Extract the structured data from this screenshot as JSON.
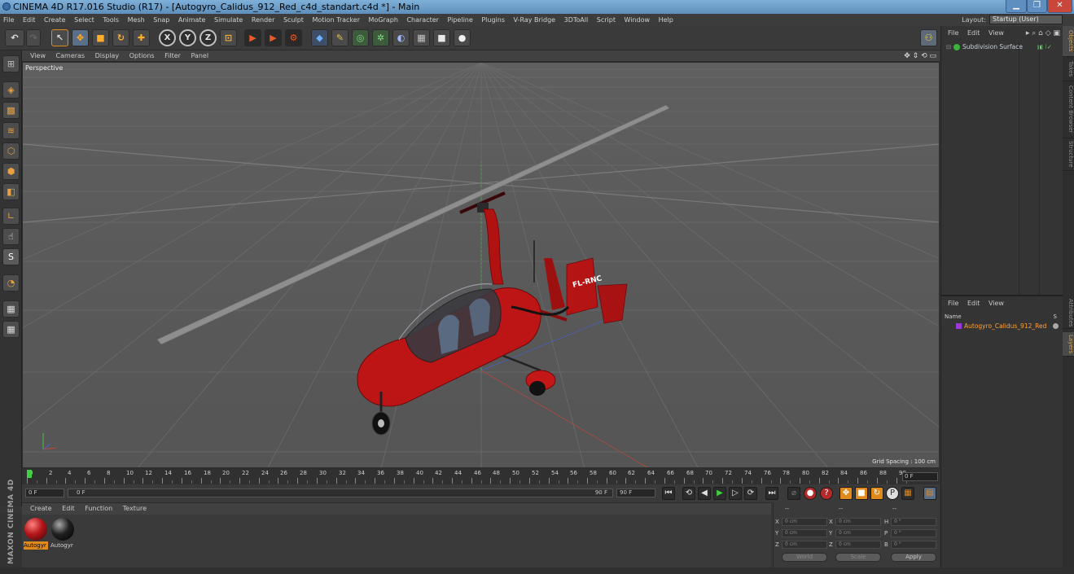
{
  "window": {
    "title": "CINEMA 4D R17.016 Studio (R17) - [Autogyro_Calidus_912_Red_c4d_standart.c4d *] - Main"
  },
  "menubar": {
    "items": [
      "File",
      "Edit",
      "Create",
      "Select",
      "Tools",
      "Mesh",
      "Snap",
      "Animate",
      "Simulate",
      "Render",
      "Sculpt",
      "Motion Tracker",
      "MoGraph",
      "Character",
      "Pipeline",
      "Plugins",
      "V-Ray Bridge",
      "3DToAll",
      "Script",
      "Window",
      "Help"
    ],
    "layout_label": "Layout:",
    "layout_value": "Startup (User)"
  },
  "toolbar": {
    "axis_x": "X",
    "axis_y": "Y",
    "axis_z": "Z"
  },
  "viewport": {
    "menu": [
      "View",
      "Cameras",
      "Display",
      "Options",
      "Filter",
      "Panel"
    ],
    "label": "Perspective",
    "grid_spacing": "Grid Spacing : 100 cm",
    "model_tail_text": "FL-RNC"
  },
  "timeline": {
    "ticks": [
      "0",
      "2",
      "4",
      "6",
      "8",
      "10",
      "12",
      "14",
      "16",
      "18",
      "20",
      "22",
      "24",
      "26",
      "28",
      "30",
      "32",
      "34",
      "36",
      "38",
      "40",
      "42",
      "44",
      "46",
      "48",
      "50",
      "52",
      "54",
      "56",
      "58",
      "60",
      "62",
      "64",
      "66",
      "68",
      "70",
      "72",
      "74",
      "76",
      "78",
      "80",
      "82",
      "84",
      "86",
      "88",
      "90"
    ],
    "current_frame": "0 F"
  },
  "transport": {
    "start_field": "0 F",
    "slider_start": "0 F",
    "slider_end": "90 F",
    "end_field": "90 F"
  },
  "materials": {
    "menu": [
      "Create",
      "Edit",
      "Function",
      "Texture"
    ],
    "items": [
      {
        "label": "Autogyr",
        "color": "#b4161a"
      },
      {
        "label": "Autogyr",
        "color": "#202020"
      }
    ]
  },
  "maxon": {
    "text": "MAXON CINEMA 4D"
  },
  "coords": {
    "header": [
      "--",
      "--",
      "--"
    ],
    "rows": [
      {
        "a": "X",
        "av": "0 cm",
        "b": "X",
        "bv": "0 cm",
        "c": "H",
        "cv": "0 °"
      },
      {
        "a": "Y",
        "av": "0 cm",
        "b": "Y",
        "bv": "0 cm",
        "c": "P",
        "cv": "0 °"
      },
      {
        "a": "Z",
        "av": "0 cm",
        "b": "Z",
        "bv": "0 cm",
        "c": "B",
        "cv": "0 °"
      }
    ],
    "world": "World",
    "scale": "Scale",
    "apply": "Apply"
  },
  "objects": {
    "menu": [
      "File",
      "Edit",
      "View"
    ],
    "item": "Subdivision Surface"
  },
  "layers": {
    "menu": [
      "File",
      "Edit",
      "View"
    ],
    "name_header": "Name",
    "s_header": "S",
    "item": "Autogyro_Calidus_912_Red"
  },
  "sidetabs": {
    "right_top": [
      "Objects",
      "Takes",
      "Content Browser",
      "Structure"
    ],
    "right_bottom": [
      "Attributes",
      "Layers"
    ]
  }
}
